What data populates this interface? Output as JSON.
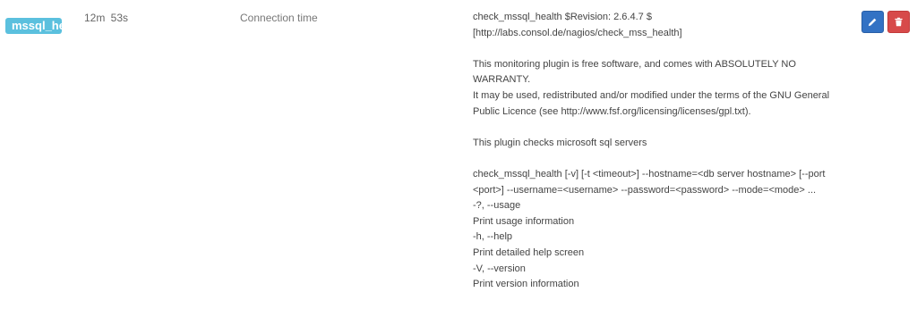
{
  "row": {
    "host_badge": "mssql_health",
    "duration": "12m 53s",
    "metric": "Connection time",
    "output_lines": [
      "check_mssql_health $Revision: 2.6.4.7 $",
      "[http://labs.consol.de/nagios/check_mss_health]",
      "",
      "This monitoring plugin is free software, and comes with ABSOLUTELY NO WARRANTY.",
      "It may be used, redistributed and/or modified under the terms of the GNU General Public Licence (see http://www.fsf.org/licensing/licenses/gpl.txt).",
      "",
      "This plugin checks microsoft sql servers",
      "",
      "check_mssql_health [-v] [-t <timeout>] --hostname=<db server hostname> [--port <port>] --username=<username> --password=<password> --mode=<mode> ...",
      "-?, --usage",
      "Print usage information",
      "-h, --help",
      "Print detailed help screen",
      "-V, --version",
      "Print version information"
    ]
  },
  "actions": {
    "edit_icon": "pencil-icon",
    "delete_icon": "trash-icon"
  },
  "colors": {
    "badge": "#5bc0de",
    "edit_button": "#3372c4",
    "delete_button": "#d74a4a"
  }
}
